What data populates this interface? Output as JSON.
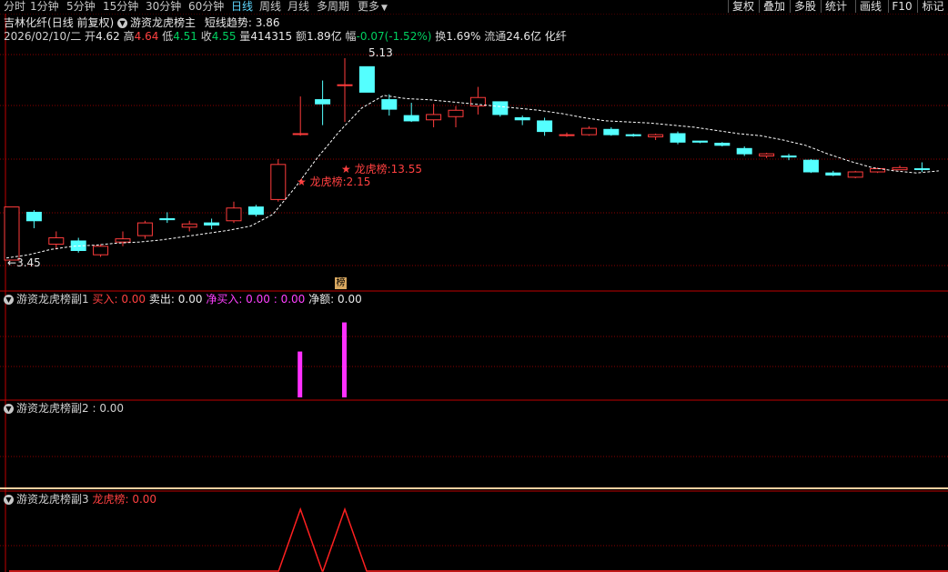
{
  "toolbar": {
    "periods": [
      "分时",
      "1分钟",
      "5分钟",
      "15分钟",
      "30分钟",
      "60分钟",
      "日线",
      "周线",
      "月线",
      "多周期",
      "更多"
    ],
    "active_period": "日线",
    "right_buttons": [
      "复权",
      "叠加",
      "多股",
      "统计",
      "画线",
      "F10",
      "标记"
    ]
  },
  "main": {
    "stock_name": "吉林化纤",
    "period_info": "(日线 前复权)",
    "indicator_name": "游资龙虎榜主",
    "trend_label": "短线趋势",
    "trend_value": ": 3.86",
    "date": "2026/02/10/二",
    "open_label": "开",
    "open": "4.62",
    "high_label": "高",
    "high": "4.64",
    "low_label": "低",
    "low": "4.51",
    "close_label": "收",
    "close": "4.55",
    "volume_label": "量",
    "volume": "414315",
    "amount_label": "额",
    "amount": "1.89亿",
    "change_label": "幅",
    "change": "-0.07(-1.52%)",
    "turnover_label": "换",
    "turnover": "1.69%",
    "float_label": "流通",
    "float": "24.6亿",
    "industry": "化纤",
    "high_mark": "5.13",
    "low_mark": "3.45",
    "annotation1": "★ 龙虎榜:2.15",
    "annotation2": "★ 龙虎榜:13.55",
    "bang_badge": "榜"
  },
  "sub1": {
    "name": "游资龙虎榜副1",
    "buy_label": "买入",
    "buy": ": 0.00",
    "sell_label": "卖出",
    "sell": ": 0.00",
    "netbuy_label": "净买入",
    "netbuy": ": 0.00 : 0.00",
    "net_label": "净额",
    "net": ": 0.00"
  },
  "sub2": {
    "name": "游资龙虎榜副2",
    "value": ": 0.00"
  },
  "sub3": {
    "name": "游资龙虎榜副3",
    "label": "龙虎榜",
    "value": ": 0.00"
  },
  "colors": {
    "up": "#ff3c3c",
    "down": "#54ffff",
    "magenta": "#ff30ff",
    "ma": "#ffffff",
    "grid": "#8b0000"
  },
  "chart_data": {
    "type": "candlestick",
    "candles": [
      {
        "o": 3.95,
        "h": 3.95,
        "l": 3.45,
        "c": 3.45,
        "up": true
      },
      {
        "o": 3.9,
        "h": 3.92,
        "l": 3.75,
        "c": 3.82,
        "up": false
      },
      {
        "o": 3.6,
        "h": 3.72,
        "l": 3.55,
        "c": 3.66,
        "up": true
      },
      {
        "o": 3.63,
        "h": 3.66,
        "l": 3.52,
        "c": 3.54,
        "up": false
      },
      {
        "o": 3.5,
        "h": 3.6,
        "l": 3.48,
        "c": 3.58,
        "up": true
      },
      {
        "o": 3.62,
        "h": 3.72,
        "l": 3.58,
        "c": 3.65,
        "up": true
      },
      {
        "o": 3.68,
        "h": 3.82,
        "l": 3.65,
        "c": 3.8,
        "up": true
      },
      {
        "o": 3.84,
        "h": 3.9,
        "l": 3.8,
        "c": 3.83,
        "up": false
      },
      {
        "o": 3.76,
        "h": 3.82,
        "l": 3.72,
        "c": 3.79,
        "up": true
      },
      {
        "o": 3.78,
        "h": 3.84,
        "l": 3.74,
        "c": 3.8,
        "up": false
      },
      {
        "o": 3.82,
        "h": 4.0,
        "l": 3.8,
        "c": 3.94,
        "up": true
      },
      {
        "o": 3.95,
        "h": 3.97,
        "l": 3.86,
        "c": 3.88,
        "up": false
      },
      {
        "o": 4.02,
        "h": 4.4,
        "l": 4.0,
        "c": 4.35,
        "up": true
      },
      {
        "o": 4.64,
        "h": 4.99,
        "l": 4.62,
        "c": 4.64,
        "up": true,
        "mag": true
      },
      {
        "o": 4.96,
        "h": 5.14,
        "l": 4.72,
        "c": 4.92,
        "up": false
      },
      {
        "o": 5.1,
        "h": 5.35,
        "l": 4.75,
        "c": 5.1,
        "up": true,
        "mag": true
      },
      {
        "o": 5.27,
        "h": 5.27,
        "l": 5.03,
        "c": 5.03,
        "up": false
      },
      {
        "o": 4.96,
        "h": 5.01,
        "l": 4.81,
        "c": 4.87,
        "up": false
      },
      {
        "o": 4.81,
        "h": 4.93,
        "l": 4.75,
        "c": 4.76,
        "up": false
      },
      {
        "o": 4.77,
        "h": 4.92,
        "l": 4.7,
        "c": 4.82,
        "up": true
      },
      {
        "o": 4.8,
        "h": 4.9,
        "l": 4.7,
        "c": 4.86,
        "up": true
      },
      {
        "o": 4.9,
        "h": 5.08,
        "l": 4.82,
        "c": 4.98,
        "up": true
      },
      {
        "o": 4.94,
        "h": 4.94,
        "l": 4.8,
        "c": 4.82,
        "up": false
      },
      {
        "o": 4.79,
        "h": 4.81,
        "l": 4.72,
        "c": 4.77,
        "up": false
      },
      {
        "o": 4.76,
        "h": 4.79,
        "l": 4.62,
        "c": 4.66,
        "up": false
      },
      {
        "o": 4.63,
        "h": 4.65,
        "l": 4.61,
        "c": 4.63,
        "up": true
      },
      {
        "o": 4.63,
        "h": 4.71,
        "l": 4.62,
        "c": 4.69,
        "up": true
      },
      {
        "o": 4.68,
        "h": 4.7,
        "l": 4.62,
        "c": 4.63,
        "up": false
      },
      {
        "o": 4.63,
        "h": 4.64,
        "l": 4.61,
        "c": 4.62,
        "up": false
      },
      {
        "o": 4.61,
        "h": 4.64,
        "l": 4.58,
        "c": 4.63,
        "up": true
      },
      {
        "o": 4.64,
        "h": 4.66,
        "l": 4.54,
        "c": 4.56,
        "up": false
      },
      {
        "o": 4.57,
        "h": 4.57,
        "l": 4.55,
        "c": 4.56,
        "up": false
      },
      {
        "o": 4.55,
        "h": 4.56,
        "l": 4.52,
        "c": 4.53,
        "up": false
      },
      {
        "o": 4.5,
        "h": 4.52,
        "l": 4.43,
        "c": 4.45,
        "up": false
      },
      {
        "o": 4.43,
        "h": 4.46,
        "l": 4.41,
        "c": 4.45,
        "up": true
      },
      {
        "o": 4.43,
        "h": 4.45,
        "l": 4.39,
        "c": 4.42,
        "up": false
      },
      {
        "o": 4.39,
        "h": 4.4,
        "l": 4.27,
        "c": 4.28,
        "up": false
      },
      {
        "o": 4.27,
        "h": 4.29,
        "l": 4.24,
        "c": 4.25,
        "up": false
      },
      {
        "o": 4.23,
        "h": 4.29,
        "l": 4.22,
        "c": 4.28,
        "up": true
      },
      {
        "o": 4.28,
        "h": 4.32,
        "l": 4.27,
        "c": 4.31,
        "up": true
      },
      {
        "o": 4.32,
        "h": 4.34,
        "l": 4.3,
        "c": 4.3,
        "up": true
      },
      {
        "o": 4.31,
        "h": 4.37,
        "l": 4.28,
        "c": 4.31,
        "up": false
      }
    ],
    "ma": [
      3.47,
      3.5,
      3.55,
      3.58,
      3.59,
      3.61,
      3.62,
      3.64,
      3.67,
      3.7,
      3.73,
      3.77,
      3.88,
      4.13,
      4.41,
      4.66,
      4.88,
      5.0,
      4.97,
      4.96,
      4.94,
      4.92,
      4.9,
      4.88,
      4.86,
      4.83,
      4.79,
      4.76,
      4.75,
      4.74,
      4.72,
      4.7,
      4.67,
      4.64,
      4.62,
      4.58,
      4.53,
      4.45,
      4.38,
      4.32,
      4.29,
      4.27,
      4.29
    ],
    "sub1_bars": [
      {
        "index": 13,
        "value": 0.52
      },
      {
        "index": 15,
        "value": 0.85
      }
    ],
    "sub3_peaks": [
      13,
      15
    ]
  }
}
